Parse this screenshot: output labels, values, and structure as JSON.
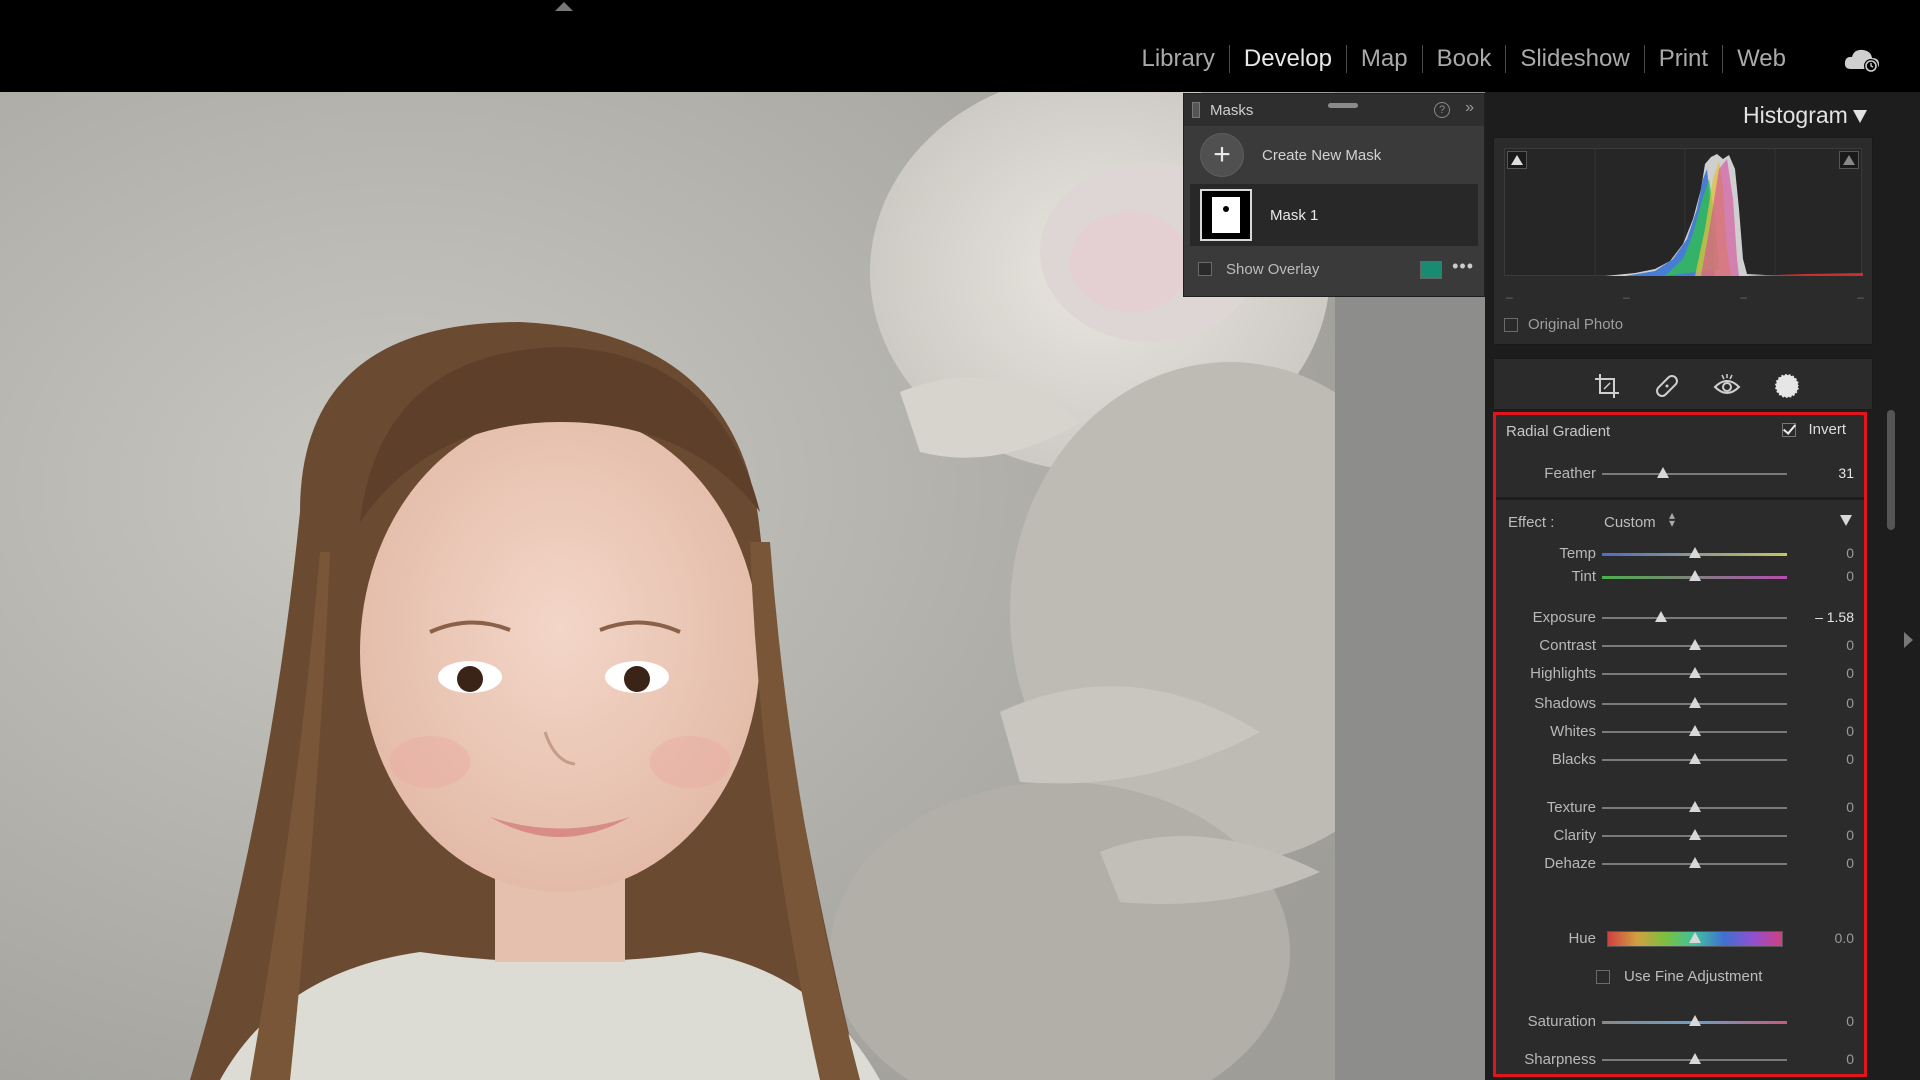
{
  "modules": [
    "Library",
    "Develop",
    "Map",
    "Book",
    "Slideshow",
    "Print",
    "Web"
  ],
  "active_module": "Develop",
  "masks_panel": {
    "title": "Masks",
    "create_label": "Create New Mask",
    "mask_name": "Mask 1",
    "show_overlay_label": "Show Overlay",
    "overlay_color": "#1a8a72"
  },
  "histogram": {
    "title": "Histogram",
    "dashes": [
      "–",
      "–",
      "–",
      "–"
    ],
    "original_photo_label": "Original Photo"
  },
  "tools": [
    "crop-icon",
    "healing-brush-icon",
    "red-eye-icon",
    "masking-icon"
  ],
  "mask_settings": {
    "type_label": "Radial Gradient",
    "invert_label": "Invert",
    "invert_checked": true,
    "feather_label": "Feather",
    "feather_value": "31",
    "effect_label": "Effect :",
    "effect_value": "Custom",
    "fine_adjust_label": "Use Fine Adjustment",
    "sliders": {
      "temp": {
        "label": "Temp",
        "value": "0",
        "position": 0.5
      },
      "tint": {
        "label": "Tint",
        "value": "0",
        "position": 0.5
      },
      "exposure": {
        "label": "Exposure",
        "value": "– 1.58",
        "position": 0.32
      },
      "contrast": {
        "label": "Contrast",
        "value": "0",
        "position": 0.5
      },
      "highlights": {
        "label": "Highlights",
        "value": "0",
        "position": 0.5
      },
      "shadows": {
        "label": "Shadows",
        "value": "0",
        "position": 0.5
      },
      "whites": {
        "label": "Whites",
        "value": "0",
        "position": 0.5
      },
      "blacks": {
        "label": "Blacks",
        "value": "0",
        "position": 0.5
      },
      "texture": {
        "label": "Texture",
        "value": "0",
        "position": 0.5
      },
      "clarity": {
        "label": "Clarity",
        "value": "0",
        "position": 0.5
      },
      "dehaze": {
        "label": "Dehaze",
        "value": "0",
        "position": 0.5
      },
      "hue": {
        "label": "Hue",
        "value": "0.0",
        "position": 0.5
      },
      "saturation": {
        "label": "Saturation",
        "value": "0",
        "position": 0.5
      },
      "sharpness": {
        "label": "Sharpness",
        "value": "0",
        "position": 0.5
      }
    },
    "feather_position": 0.33,
    "highlight_color": "#e0151b"
  }
}
